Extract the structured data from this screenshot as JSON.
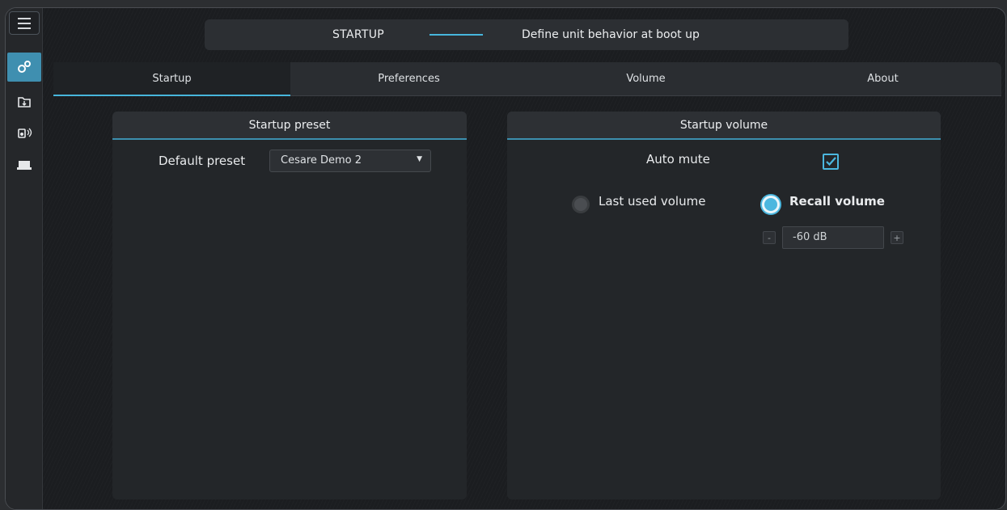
{
  "header": {
    "title": "STARTUP",
    "subtitle": "Define unit behavior at boot up"
  },
  "sidebar": {
    "items": [
      {
        "icon": "menu-icon"
      },
      {
        "icon": "settings-gears-icon",
        "active": true
      },
      {
        "icon": "folder-download-icon"
      },
      {
        "icon": "speaker-icon"
      },
      {
        "icon": "device-icon"
      }
    ]
  },
  "tabs": [
    {
      "label": "Startup",
      "active": true
    },
    {
      "label": "Preferences"
    },
    {
      "label": "Volume"
    },
    {
      "label": "About"
    }
  ],
  "startup_preset": {
    "title": "Startup preset",
    "default_preset_label": "Default preset",
    "default_preset_value": "Cesare Demo 2"
  },
  "startup_volume": {
    "title": "Startup volume",
    "auto_mute_label": "Auto mute",
    "auto_mute_checked": true,
    "last_used_label": "Last used volume",
    "recall_label": "Recall volume",
    "selected": "recall",
    "volume_value": "-60 dB",
    "minus": "-",
    "plus": "+"
  },
  "colors": {
    "accent": "#47b6dc",
    "background": "#1b1d20",
    "panel": "#232629"
  }
}
